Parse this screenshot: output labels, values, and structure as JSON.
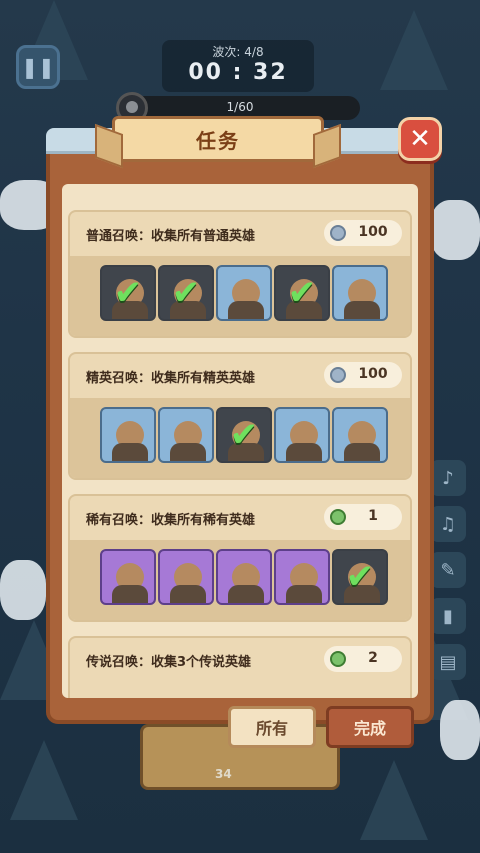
{
  "hud": {
    "wave_label": "波次: 4/8",
    "timer": "00 : 32",
    "enemy_count": "1/60"
  },
  "dialog": {
    "title": "任务",
    "close_icon": "close-icon"
  },
  "quests": [
    {
      "title": "普通召唤：收集所有普通英雄",
      "reward_icon": "silver-coin-icon",
      "reward_value": "100",
      "heroes": [
        {
          "name": "hero-rogue-icon",
          "completed": true,
          "tier": "gray"
        },
        {
          "name": "hero-knight-icon",
          "completed": true,
          "tier": "gray"
        },
        {
          "name": "hero-spirit-icon",
          "completed": false,
          "tier": "blue"
        },
        {
          "name": "hero-archer-icon",
          "completed": true,
          "tier": "gray"
        },
        {
          "name": "hero-elf-icon",
          "completed": false,
          "tier": "blue"
        }
      ]
    },
    {
      "title": "精英召唤：收集所有精英英雄",
      "reward_icon": "silver-coin-icon",
      "reward_value": "100",
      "heroes": [
        {
          "name": "hero-blonde-archer-icon",
          "completed": false,
          "tier": "blue"
        },
        {
          "name": "hero-hammer-icon",
          "completed": false,
          "tier": "blue"
        },
        {
          "name": "hero-hooded-icon",
          "completed": true,
          "tier": "gray"
        },
        {
          "name": "hero-nun-icon",
          "completed": false,
          "tier": "blue"
        },
        {
          "name": "hero-demon-icon",
          "completed": false,
          "tier": "blue"
        }
      ]
    },
    {
      "title": "稀有召唤：收集所有稀有英雄",
      "reward_icon": "green-gem-icon",
      "reward_value": "1",
      "heroes": [
        {
          "name": "hero-crystal-icon",
          "completed": false,
          "tier": "purple"
        },
        {
          "name": "hero-harpist-icon",
          "completed": false,
          "tier": "purple"
        },
        {
          "name": "hero-wizard-icon",
          "completed": false,
          "tier": "purple"
        },
        {
          "name": "hero-owl-icon",
          "completed": false,
          "tier": "purple"
        },
        {
          "name": "hero-dark-ranger-icon",
          "completed": true,
          "tier": "gray"
        }
      ]
    },
    {
      "title": "传说召唤：收集3个传说英雄",
      "reward_icon": "green-gem-icon",
      "reward_value": "2",
      "heroes": []
    }
  ],
  "buttons": {
    "all": "所有",
    "done": "完成"
  },
  "chest": {
    "cost": "34"
  }
}
